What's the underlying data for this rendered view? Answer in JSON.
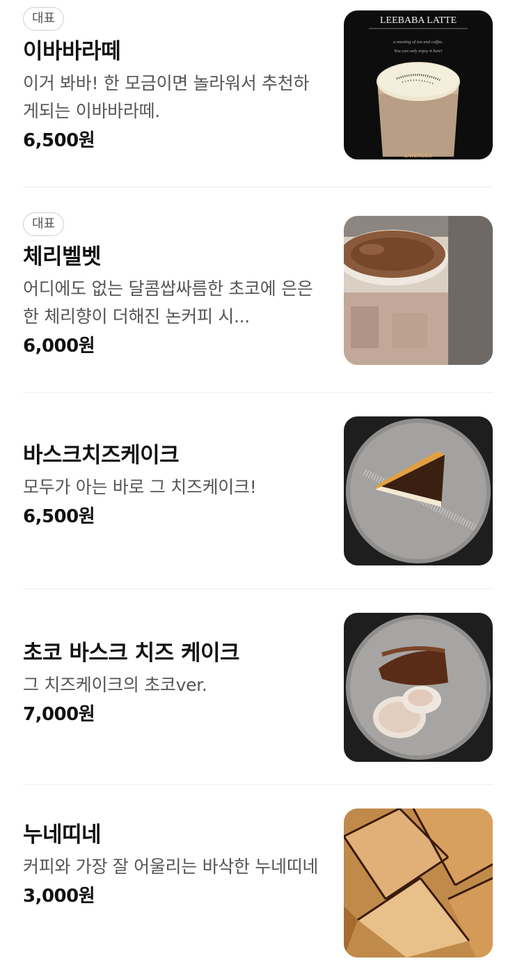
{
  "menu": {
    "items": [
      {
        "badge": "대표",
        "name": "이바바라떼",
        "description": "이거 봐바! 한 모금이면 놀라워서 추천하게되는 이바바라떼.",
        "price": "6,500원",
        "image_title": "LEEBABA LATTE",
        "image_subtitle_1": "a meeting of tea and coffee.",
        "image_subtitle_2": "You can only enjoy it here!",
        "image_footer": "LAVENDER"
      },
      {
        "badge": "대표",
        "name": "체리벨벳",
        "description": "어디에도 없는 달콤쌉싸름한 초코에 은은한 체리향이 더해진 논커피 시...",
        "price": "6,000원"
      },
      {
        "name": "바스크치즈케이크",
        "description": "모두가 아는 바로 그 치즈케이크!",
        "price": "6,500원"
      },
      {
        "name": "초코 바스크 치즈 케이크",
        "description": "그 치즈케이크의 초코ver.",
        "price": "7,000원"
      },
      {
        "name": "누네띠네",
        "description": "커피와 가장 잘 어울리는 바삭한 누네띠네",
        "price": "3,000원"
      }
    ]
  }
}
